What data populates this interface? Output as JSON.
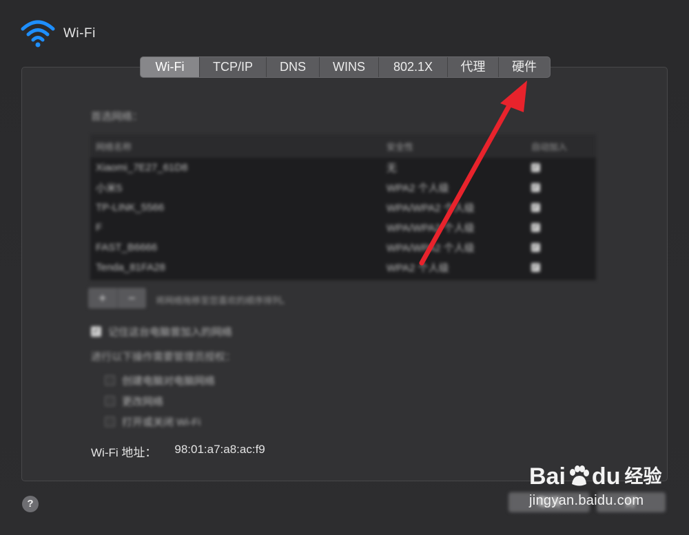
{
  "window": {
    "title": "Wi-Fi"
  },
  "tabs": [
    {
      "label": "Wi-Fi",
      "active": true
    },
    {
      "label": "TCP/IP",
      "active": false
    },
    {
      "label": "DNS",
      "active": false
    },
    {
      "label": "WINS",
      "active": false
    },
    {
      "label": "802.1X",
      "active": false
    },
    {
      "label": "代理",
      "active": false
    },
    {
      "label": "硬件",
      "active": false
    }
  ],
  "preferred_networks": {
    "label": "首选网络：",
    "columns": [
      "网络名称",
      "安全性",
      "自动加入"
    ],
    "rows": [
      {
        "name": "Xiaomi_7E27_61D8",
        "security": "无",
        "auto_join": true
      },
      {
        "name": "小米5",
        "security": "WPA2 个人级",
        "auto_join": true
      },
      {
        "name": "TP-LINK_5566",
        "security": "WPA/WPA2 个人级",
        "auto_join": true
      },
      {
        "name": "F",
        "security": "WPA/WPA2 个人级",
        "auto_join": true
      },
      {
        "name": "FAST_B6666",
        "security": "WPA/WPA2 个人级",
        "auto_join": true
      },
      {
        "name": "Tenda_81FA28",
        "security": "WPA2 个人级",
        "auto_join": true
      }
    ]
  },
  "buttons": {
    "add": "+",
    "remove": "−"
  },
  "hint": "将网络拖移至您喜欢的顺序排列。",
  "remember_option": {
    "label": "记住这台电脑曾加入的网络",
    "checked": true
  },
  "admin_section": {
    "label": "进行以下操作需要管理员授权：",
    "options": [
      {
        "label": "创建电脑对电脑网络",
        "checked": false
      },
      {
        "label": "更改网络",
        "checked": false
      },
      {
        "label": "打开或关闭 Wi-Fi",
        "checked": false
      }
    ]
  },
  "wifi_address": {
    "label": "Wi-Fi 地址：",
    "value": "98:01:a7:a8:ac:f9"
  },
  "footer": {
    "help": "?",
    "cancel": "取消",
    "ok": "好"
  },
  "watermark": {
    "brand": "Bai",
    "brand2": "du",
    "cn": "经验",
    "url": "jingyan.baidu.com"
  },
  "colors": {
    "annotation_arrow": "#e8232c",
    "tab_active": "#87878a"
  }
}
